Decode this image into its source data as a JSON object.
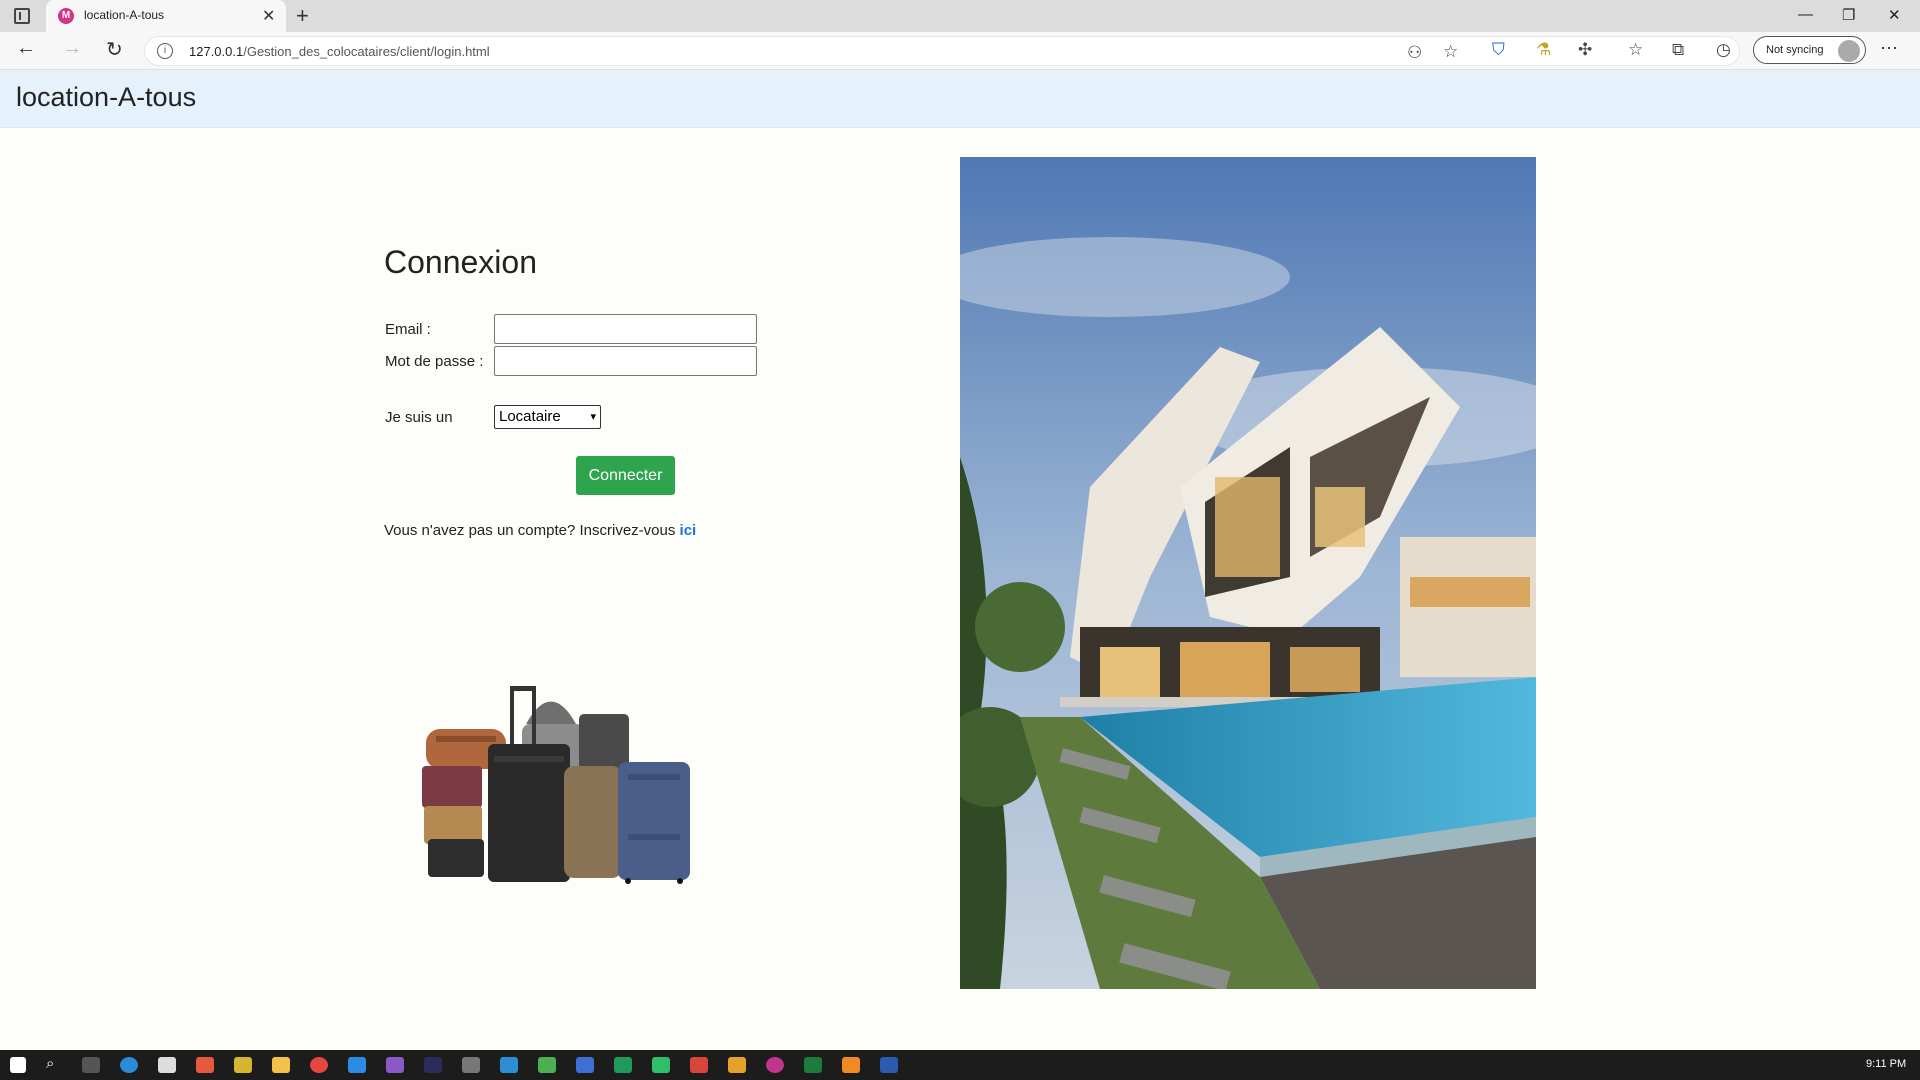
{
  "browser": {
    "tab_title": "location-A-tous",
    "favicon_letter": "M",
    "url_host": "127.0.0.1",
    "url_path": "/Gestion_des_colocataires/client/login.html",
    "sync_label": "Not syncing"
  },
  "site": {
    "brand": "location-A-tous"
  },
  "login": {
    "title": "Connexion",
    "email_label": "Email :",
    "email_value": "",
    "password_label": "Mot de passe :",
    "password_value": "",
    "role_label": "Je suis un",
    "role_selected": "Locataire",
    "submit_label": "Connecter",
    "signup_text": "Vous n'avez pas un compte? Inscrivez-vous",
    "signup_link": "ici"
  },
  "colors": {
    "header_bg": "#e5f2fb",
    "button_green": "#2ea44f",
    "link_blue": "#1a73e8",
    "taskbar_bg": "#1c1c1c"
  },
  "taskbar": {
    "clock": "9:11 PM"
  }
}
